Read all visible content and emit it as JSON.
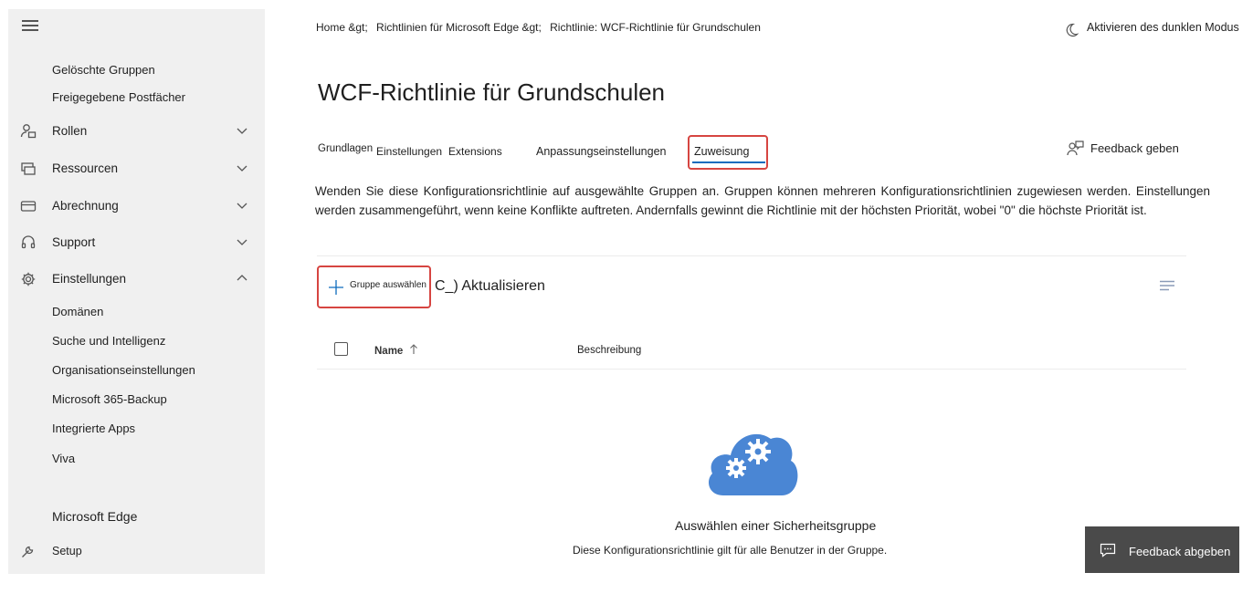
{
  "sidebar": {
    "menu_icon": "hamburger-icon",
    "sub_top": [
      "Gelöschte Gruppen",
      "Freigegebene Postfächer"
    ],
    "items": [
      {
        "label": "Rollen",
        "icon": "roles-icon"
      },
      {
        "label": "Ressourcen",
        "icon": "resources-icon"
      },
      {
        "label": "Abrechnung",
        "icon": "billing-icon"
      },
      {
        "label": "Support",
        "icon": "headset-icon"
      },
      {
        "label": "Einstellungen",
        "icon": "gear-icon"
      }
    ],
    "settings_sub": [
      "Domänen",
      "Suche und Intelligenz",
      "Organisationseinstellungen",
      "Microsoft 365-Backup",
      "Integrierte Apps",
      "Viva"
    ],
    "edge": "Microsoft Edge",
    "setup": {
      "label": "Setup",
      "icon": "wrench-icon"
    }
  },
  "breadcrumb": [
    "Home &gt;",
    "Richtlinien für Microsoft Edge &gt;",
    "Richtlinie: WCF-Richtlinie für Grundschulen"
  ],
  "dark_mode": {
    "label": "Aktivieren des dunklen Modus",
    "icon": "moon-icon"
  },
  "page_title": "WCF-Richtlinie für Grundschulen",
  "tabs": [
    "Grundlagen",
    "Einstellungen",
    "Extensions",
    "Anpassungseinstellungen",
    "Zuweisung"
  ],
  "feedback_top": {
    "label": "Feedback geben",
    "icon": "feedback-person-icon"
  },
  "description": "Wenden Sie diese Konfigurationsrichtlinie auf ausgewählte Gruppen an. Gruppen können mehreren Konfigurationsrichtlinien zugewiesen werden. Einstellungen werden zusammengeführt, wenn keine Konflikte auftreten. Andernfalls gewinnt die Richtlinie mit der höchsten Priorität, wobei \"0\" die höchste Priorität ist.",
  "toolbar": {
    "add_label": "Gruppe auswählen",
    "refresh_label": "C_) Aktualisieren",
    "list_options_icon": "list-options-icon"
  },
  "table": {
    "col_name": "Name",
    "col_desc": "Beschreibung",
    "sort_icon": "sort-ascending-icon"
  },
  "empty": {
    "title": "Auswählen einer Sicherheitsgruppe",
    "text": "Diese Konfigurationsrichtlinie gilt für alle Benutzer in der Gruppe.",
    "icon": "cloud-gears-icon"
  },
  "feedback_float": {
    "label": "Feedback abgeben",
    "icon": "chat-icon"
  },
  "colors": {
    "accent": "#0f6cbd",
    "highlight": "#d64541",
    "sidebar_bg": "#f0f0f0",
    "cloud": "#4a86d4"
  }
}
